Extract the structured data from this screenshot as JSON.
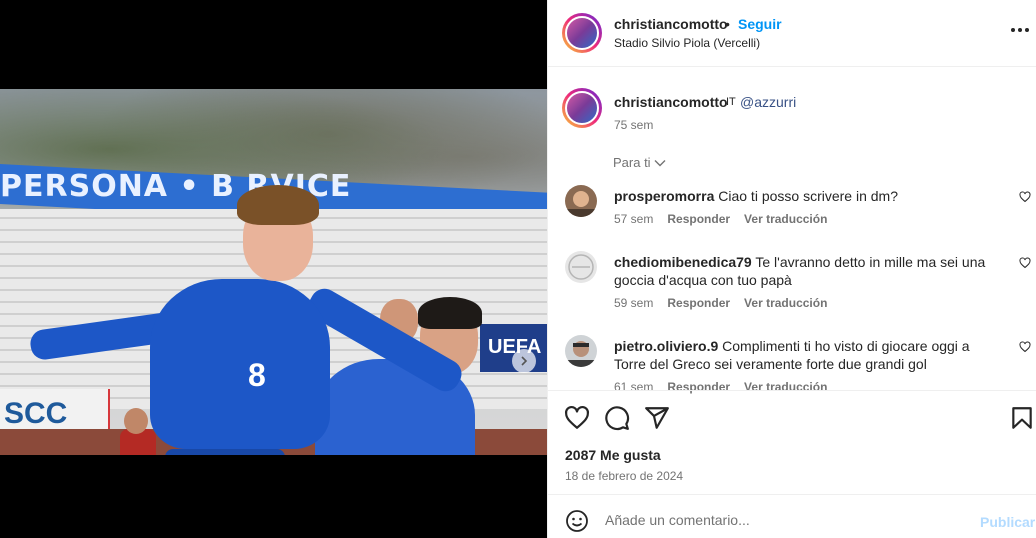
{
  "post": {
    "banner_text": "PERSONA  •  B  RVICE",
    "sponsor_text": "SCC",
    "uefa_text": "UEFA",
    "jersey_number": "8",
    "carousel_dots": 2,
    "carousel_active": 0
  },
  "header": {
    "username": "christiancomotto",
    "separator": "•",
    "follow_label": "Seguir",
    "location": "Stadio Silvio Piola (Vercelli)",
    "more_icon": "more-options-icon"
  },
  "caption": {
    "username": "christiancomotto",
    "flag": "IT",
    "mention": "@azzurri",
    "time": "75 sem"
  },
  "sort": {
    "label": "Para ti"
  },
  "comments": [
    {
      "username": "prosperomorra",
      "text": "Ciao ti posso scrivere in dm?",
      "time": "57 sem",
      "reply": "Responder",
      "translate": "Ver traducción"
    },
    {
      "username": "chediomibenedica79",
      "text": "Te l'avranno detto in mille ma sei una goccia d'acqua con tuo papà",
      "time": "59 sem",
      "reply": "Responder",
      "translate": "Ver traducción"
    },
    {
      "username": "pietro.oliviero.9",
      "text": "Complimenti ti ho visto di giocare oggi a Torre del Greco sei veramente forte due grandi gol",
      "time": "61 sem",
      "reply": "Responder",
      "translate": "Ver traducción"
    }
  ],
  "actions": {
    "likes": "2087 Me gusta",
    "date": "18 de febrero de 2024"
  },
  "add_comment": {
    "placeholder": "Añade un comentario...",
    "publish_label": "Publicar"
  },
  "colors": {
    "accent": "#0095f6",
    "mention": "#385185",
    "muted": "#737373",
    "publish_disabled": "#b3dbff"
  }
}
